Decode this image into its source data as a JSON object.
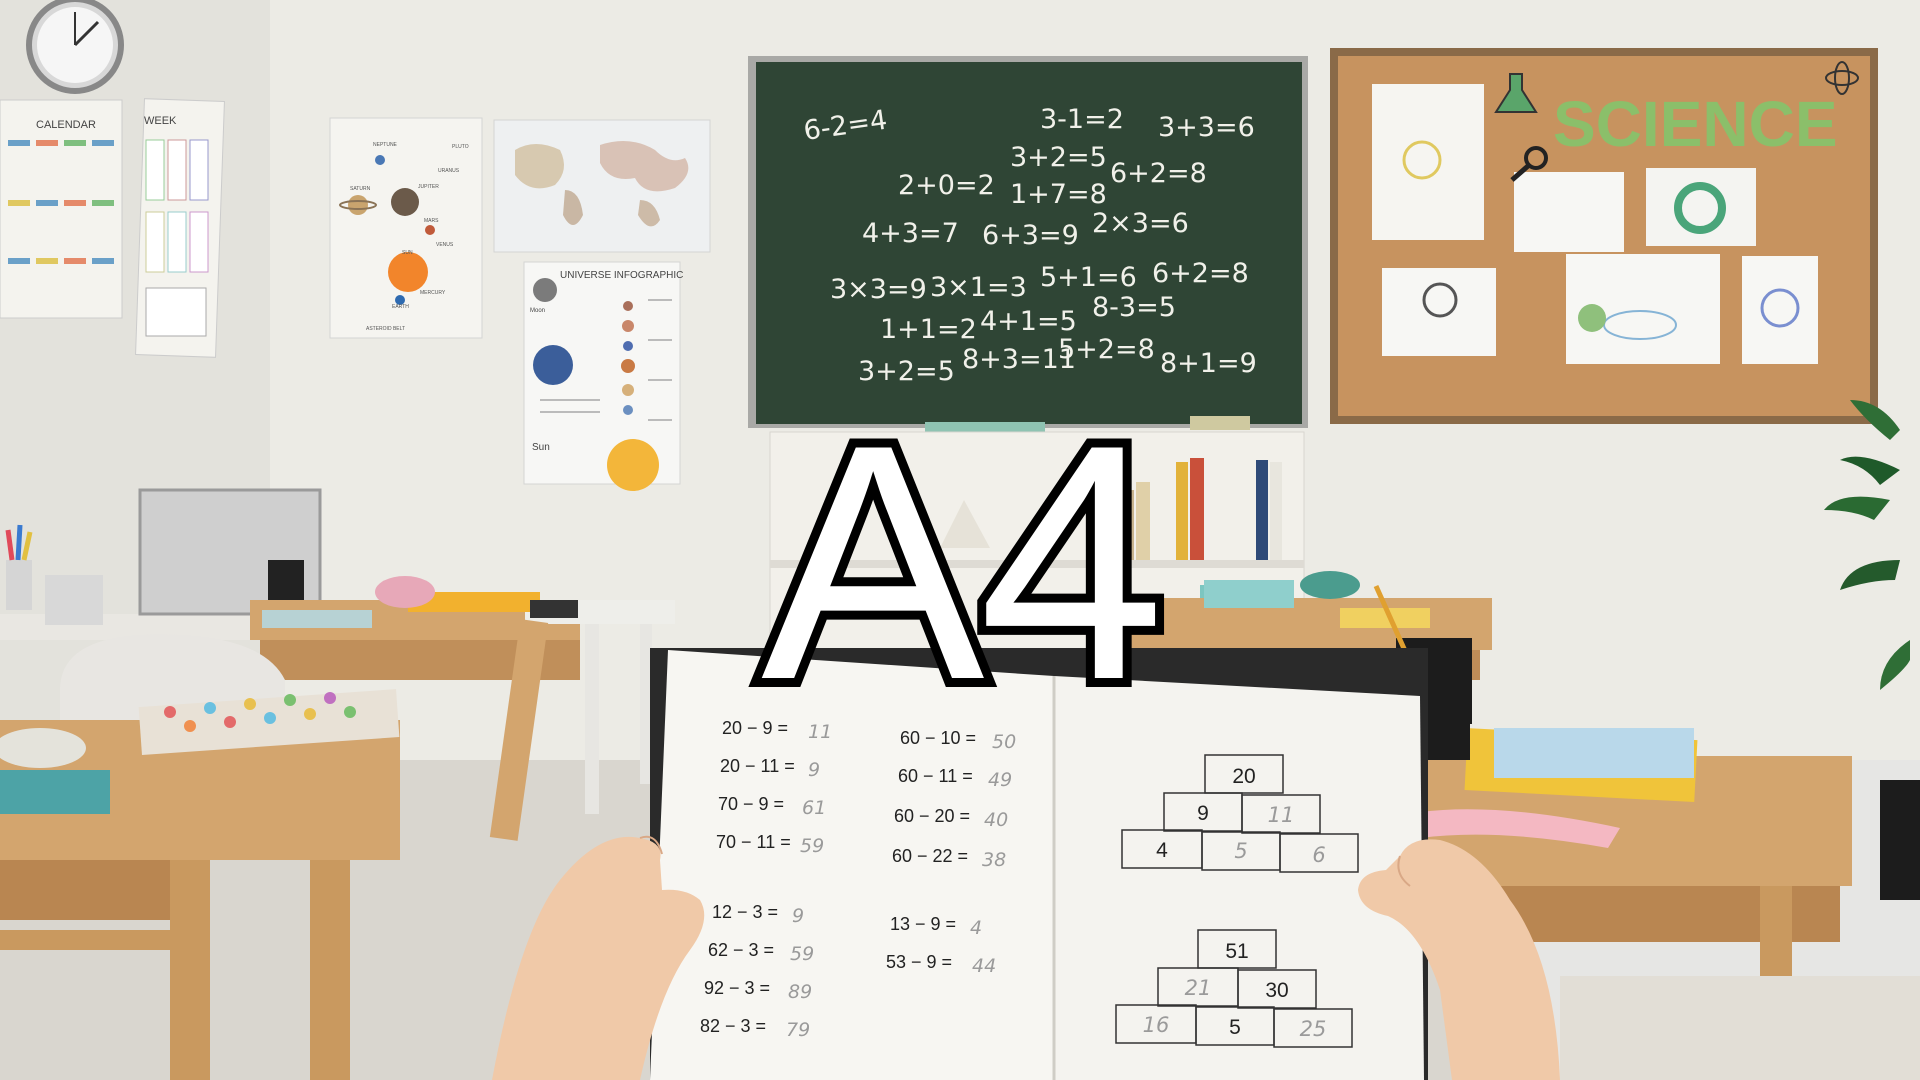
{
  "overlay": {
    "title": "A4"
  },
  "posters": {
    "calendar_title": "CALENDAR",
    "week_title": "WEEK",
    "universe_title": "UNIVERSE INFOGRAPHIC",
    "universe_moon": "Moon",
    "universe_sun": "Sun",
    "solar_labels": [
      "NEPTUNE",
      "PLUTO",
      "SATURN",
      "JUPITER",
      "URANUS",
      "MARS",
      "VENUS",
      "EARTH",
      "MERCURY",
      "SUN",
      "ASTEROID BELT"
    ]
  },
  "board": {
    "science_title": "SCIENCE",
    "chalk": [
      "6-2=4",
      "3-1=2",
      "3+3=6",
      "3+2=5",
      "2+0=2",
      "6+2=8",
      "1+7=8",
      "4+3=7",
      "6+3=9",
      "2×3=6",
      "3×3=9",
      "3×1=3",
      "5+1=6",
      "6+2=8",
      "8-3=5",
      "1+1=2",
      "4+1=5",
      "3+2=5",
      "8+3=11",
      "5+2=8",
      "8+1=9"
    ]
  },
  "notebook": {
    "left_exercises": [
      {
        "expr": "20 − 9 =",
        "answer": "11"
      },
      {
        "expr": "20 − 11 =",
        "answer": "9"
      },
      {
        "expr": "70 − 9 =",
        "answer": "61"
      },
      {
        "expr": "70 − 11 =",
        "answer": "59"
      },
      {
        "expr": "12 − 3 =",
        "answer": "9"
      },
      {
        "expr": "62 − 3 =",
        "answer": "59"
      },
      {
        "expr": "92 − 3 =",
        "answer": "89"
      },
      {
        "expr": "82 − 3 =",
        "answer": "79"
      }
    ],
    "right_exercises": [
      {
        "expr": "60 − 10 =",
        "answer": "50"
      },
      {
        "expr": "60 − 11 =",
        "answer": "49"
      },
      {
        "expr": "60 − 20 =",
        "answer": "40"
      },
      {
        "expr": "60 − 22 =",
        "answer": "38"
      },
      {
        "expr": "13 − 9 =",
        "answer": "4"
      },
      {
        "expr": "53 − 9 =",
        "answer": "44"
      }
    ],
    "pyramid1": {
      "top": "20",
      "mid": [
        "9",
        "11"
      ],
      "bottom": [
        "4",
        "5",
        "6"
      ]
    },
    "pyramid2": {
      "top": "51",
      "mid": [
        "21",
        "30"
      ],
      "bottom": [
        "16",
        "5",
        "25"
      ]
    }
  },
  "colors": {
    "wall": "#ecebe6",
    "chalkboard": "#2f4535",
    "cork": "#c7935f",
    "desk": "#d3a56e",
    "overlay_stroke": "#000000",
    "overlay_fill": "#ffffff"
  }
}
